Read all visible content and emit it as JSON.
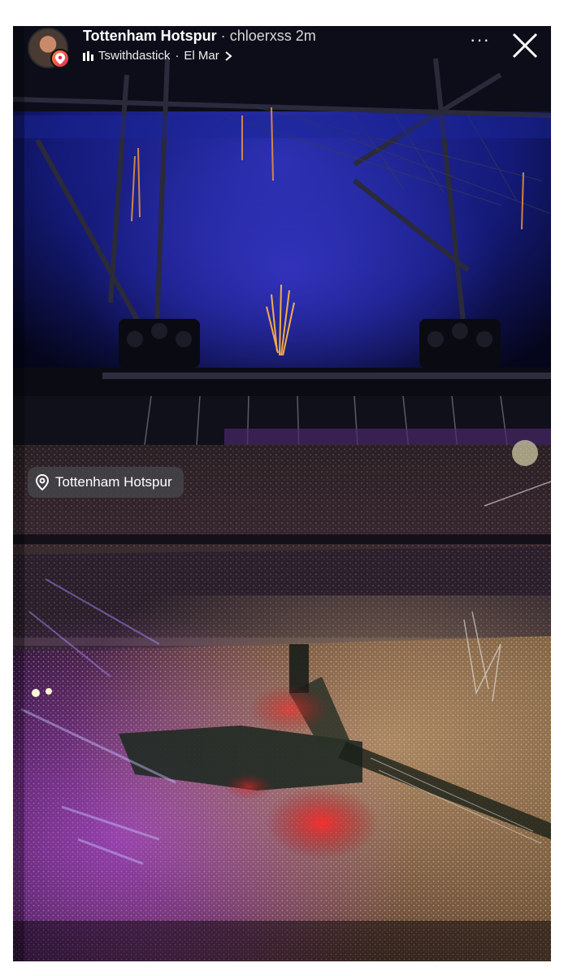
{
  "story": {
    "account_name": "Tottenham Hotspur",
    "separator": "·",
    "username": "chloerxss",
    "time_ago": "2m",
    "music_track": "Tswithdastick",
    "music_separator": "·",
    "music_artist": "El Mar",
    "more_label": "···",
    "location_sticker": "Tottenham Hotspur"
  },
  "icons": {
    "avatar": "profile-photo",
    "badge": "location-pin-icon",
    "music": "audio-bars-icon",
    "chevron": "chevron-right-icon",
    "close": "close-icon",
    "sticker_pin": "location-pin-icon"
  },
  "colors": {
    "sky": "#1a1f8f",
    "stage_purple": "#8a2fa8",
    "crowd_glow": "#d9a56a",
    "badge_gradient_start": "#ff8a3d",
    "badge_gradient_end": "#e4285b"
  }
}
